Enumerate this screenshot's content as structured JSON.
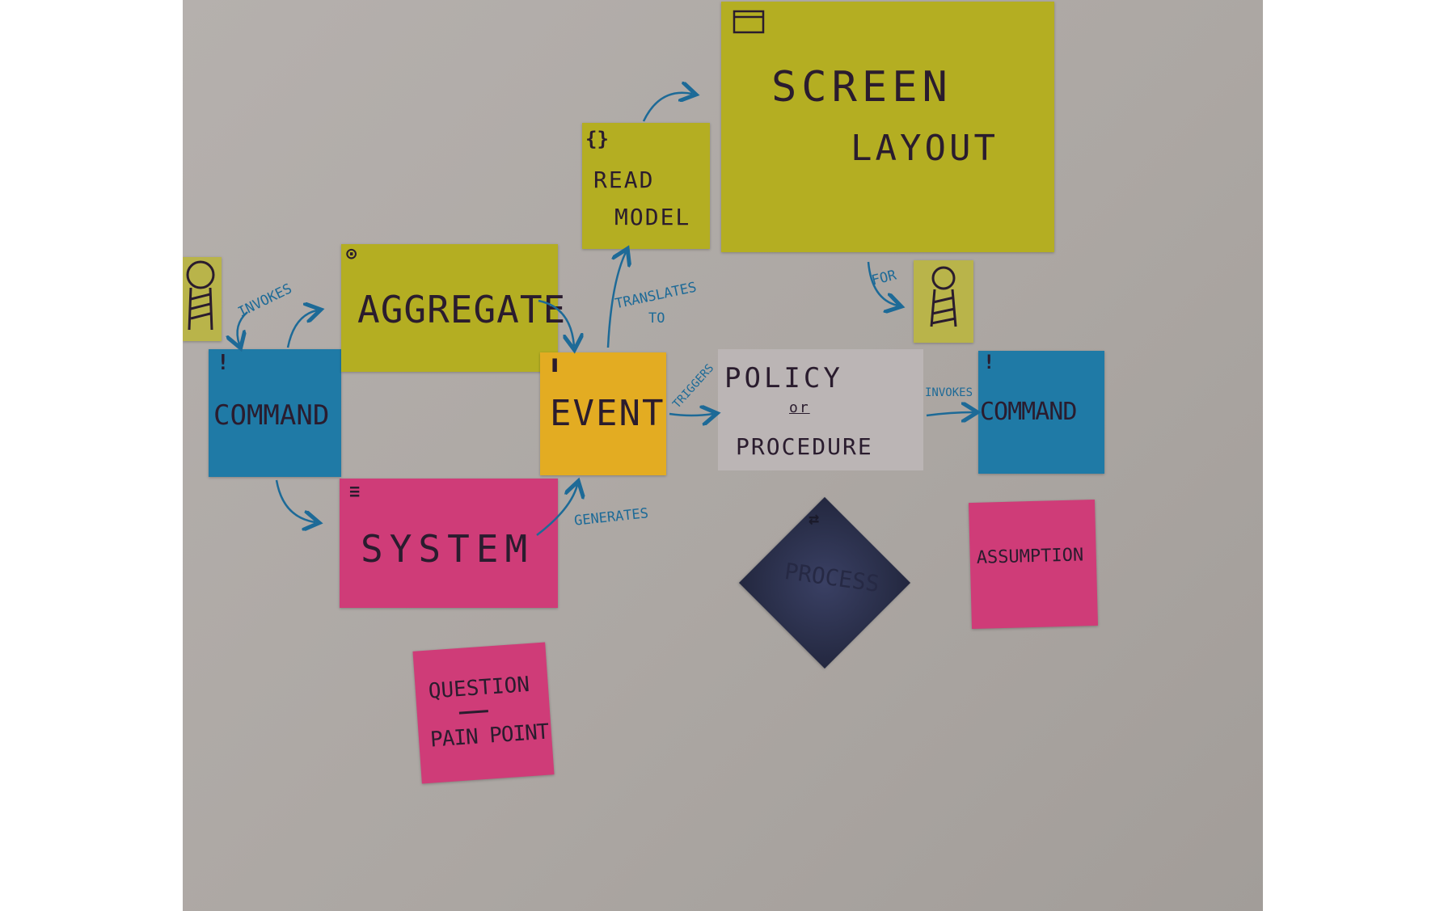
{
  "notes": {
    "aggregate": "AGGREGATE",
    "command_left": "COMMAND",
    "command_right": "COMMAND",
    "event": "EVENT",
    "read_model_line1": "READ",
    "read_model_line2": "MODEL",
    "screen_layout_line1": "SCREEN",
    "screen_layout_line2": "LAYOUT",
    "policy_line1": "POLICY",
    "policy_line2": "or",
    "policy_line3": "PROCEDURE",
    "system": "SYSTEM",
    "process": "PROCESS",
    "assumption": "ASSUMPTION",
    "question": "QUESTION",
    "pain_point": "PAIN POINT"
  },
  "arrows": {
    "invokes_left": "INVOKES",
    "invokes_right": "INVOKES",
    "translates_line1": "TRANSLATES",
    "translates_line2": "TO",
    "triggers": "TRIGGERS",
    "generates": "GENERATES",
    "for": "FOR"
  },
  "icons": [
    "actor-icon",
    "aggregate-icon",
    "command-icon",
    "event-icon",
    "read-model-icon",
    "screen-window-icon",
    "system-icon",
    "process-icon"
  ],
  "colors": {
    "wall": "#aca7a3",
    "yellow_note": "#b4ae22",
    "blue_note": "#1f7aa6",
    "pink_note": "#cf3c78",
    "orange_note": "#e3ac22",
    "process_note": "#2f3452",
    "ink": "#2a1c2e",
    "arrow_ink": "#1d6a97"
  }
}
